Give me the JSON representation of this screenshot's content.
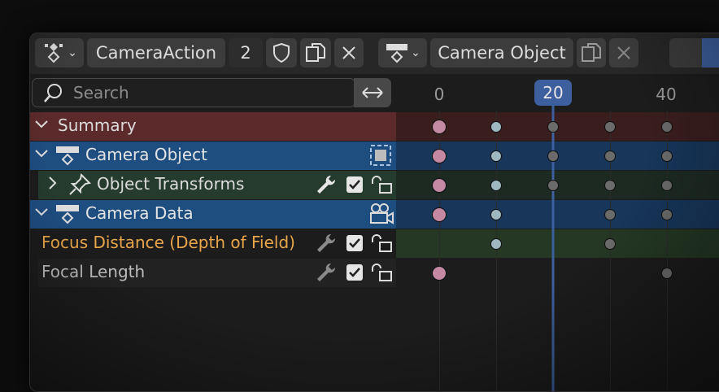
{
  "header": {
    "action_selector": {
      "name": "CameraAction",
      "users": "2"
    },
    "object_selector": {
      "name": "Camera Object"
    }
  },
  "search": {
    "placeholder": "Search"
  },
  "channels": [
    {
      "label": "Summary",
      "kind": "summary",
      "color": "#5c2a2a",
      "text_color": "#dcdcdc"
    },
    {
      "label": "Camera Object",
      "kind": "object",
      "color": "#1e4d80",
      "text_color": "#e4e4e4"
    },
    {
      "label": "Object Transforms",
      "kind": "group",
      "color": "#243b2e",
      "text_color": "#dcdcdc"
    },
    {
      "label": "Camera Data",
      "kind": "data",
      "color": "#1e4d80",
      "text_color": "#e4e4e4"
    },
    {
      "label": "Focus Distance (Depth of Field)",
      "kind": "fcurve",
      "color": "#1c1c1c",
      "text_color": "#e8a54a"
    },
    {
      "label": "Focal Length",
      "kind": "fcurve",
      "color": "#1c1c1c",
      "text_color": "#bdbdbd"
    }
  ],
  "timeline": {
    "ticks": [
      "0",
      "40"
    ],
    "current_frame": "20",
    "keyframe_columns": [
      0,
      10,
      20,
      30,
      40
    ],
    "rows": [
      [
        0,
        10,
        20,
        30,
        40
      ],
      [
        0,
        10,
        20,
        30,
        40
      ],
      [
        0,
        10,
        20,
        30,
        40
      ],
      [
        0,
        10,
        30,
        40
      ],
      [
        10,
        30
      ],
      [
        0,
        40
      ]
    ],
    "selected_key_frame": 0,
    "colors": {
      "selected": "#c48aa3",
      "light": "#9fb7c0",
      "normal": "#6b6b6b",
      "summary_band": "#3a1e1e",
      "object_band": "#17365a",
      "group_band": "#1c2a22",
      "focus_band": "#243824",
      "accent": "#3d5f9e"
    }
  }
}
